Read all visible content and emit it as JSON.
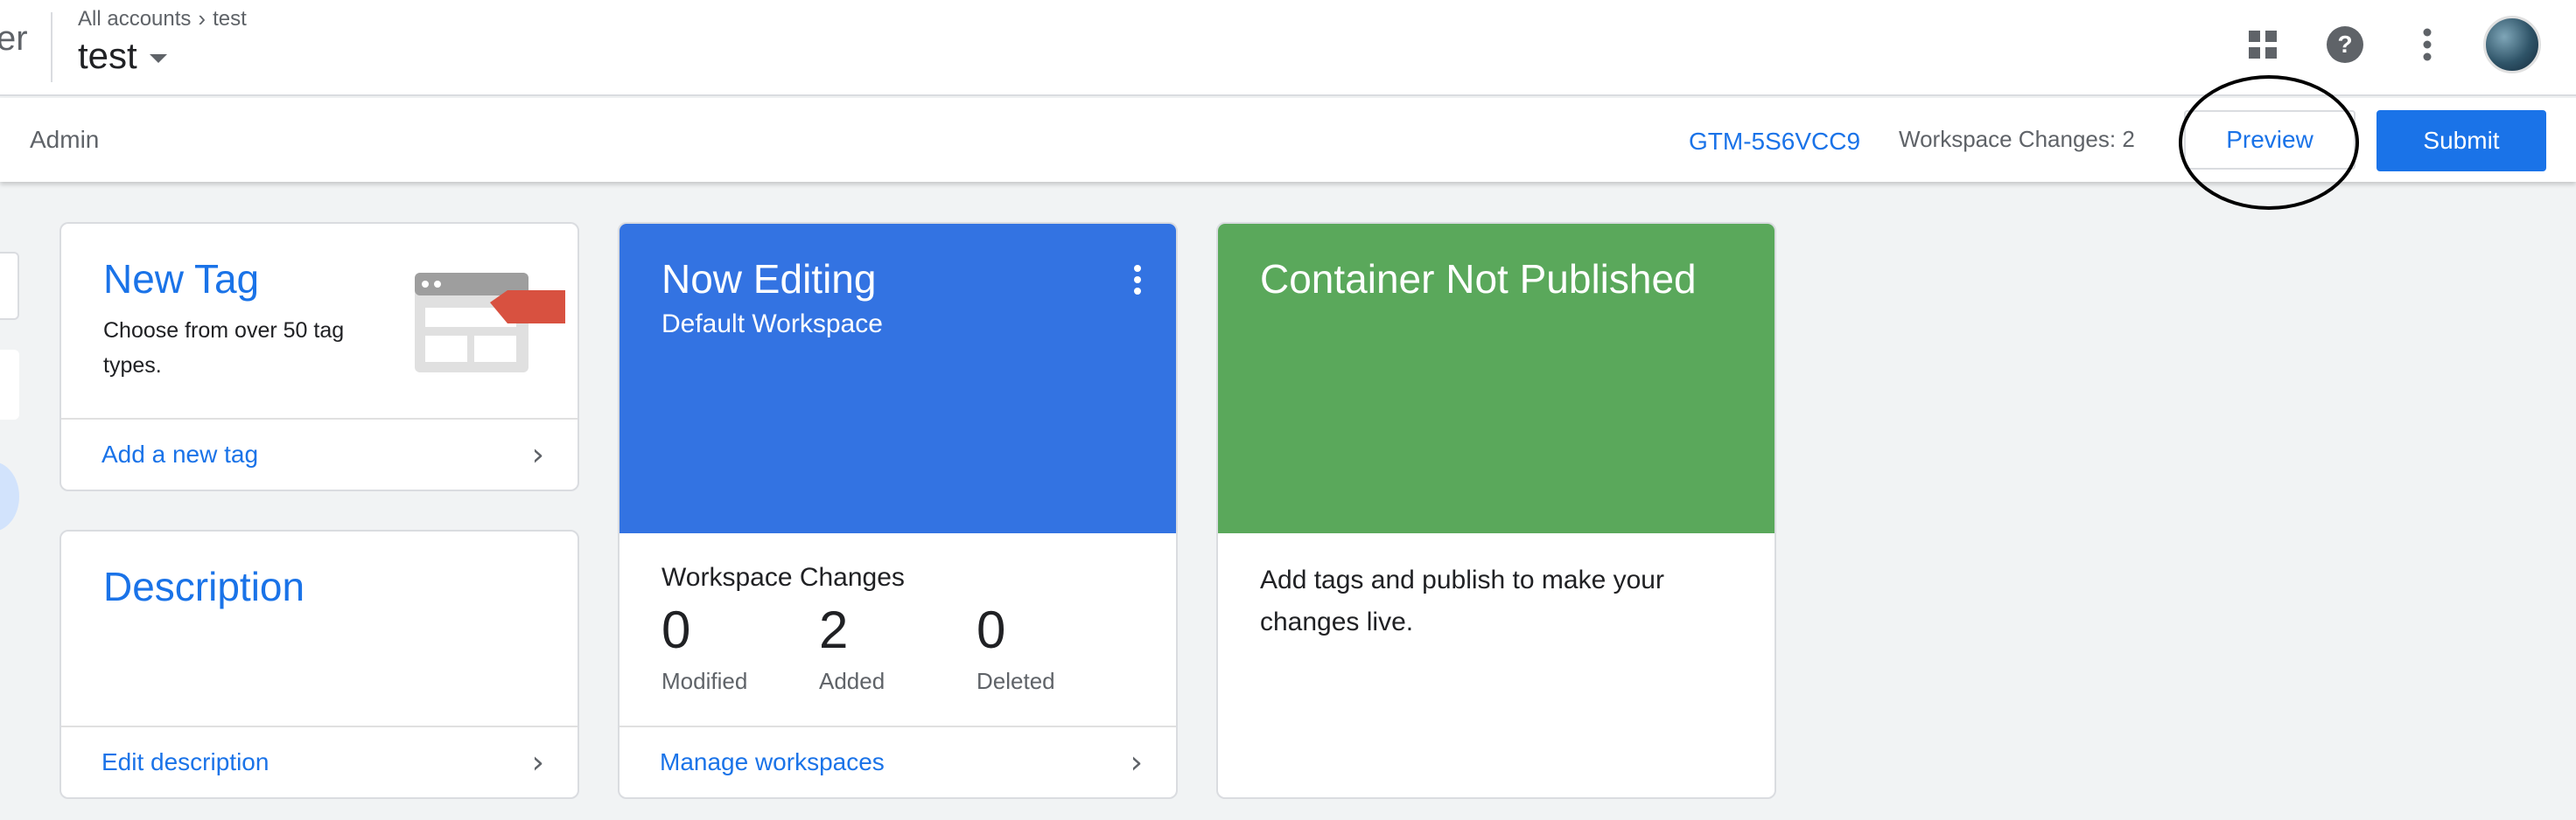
{
  "header": {
    "logo_fragment": "er",
    "breadcrumb": {
      "root": "All accounts",
      "separator": "›",
      "current": "test"
    },
    "container_name": "test",
    "icons": [
      "apps-grid-icon",
      "help-icon",
      "more-vert-icon",
      "avatar"
    ]
  },
  "toolbar": {
    "admin_label": "Admin",
    "container_id": "GTM-5S6VCC9",
    "workspace_changes": "Workspace Changes: 2",
    "preview_label": "Preview",
    "submit_label": "Submit"
  },
  "cards": {
    "new_tag": {
      "title": "New Tag",
      "description": "Choose from over 50 tag types.",
      "link": "Add a new tag"
    },
    "description": {
      "title": "Description",
      "link": "Edit description"
    },
    "now_editing": {
      "title": "Now Editing",
      "workspace": "Default Workspace",
      "changes_label": "Workspace Changes",
      "stats": [
        {
          "value": "0",
          "label": "Modified"
        },
        {
          "value": "2",
          "label": "Added"
        },
        {
          "value": "0",
          "label": "Deleted"
        }
      ],
      "link": "Manage workspaces"
    },
    "not_published": {
      "title": "Container Not Published",
      "text": "Add tags and publish to make your changes live."
    }
  },
  "colors": {
    "accent_blue": "#1a73e8",
    "editing_blue": "#3373e2",
    "published_green": "#5aa85b",
    "tag_red": "#d85140"
  }
}
